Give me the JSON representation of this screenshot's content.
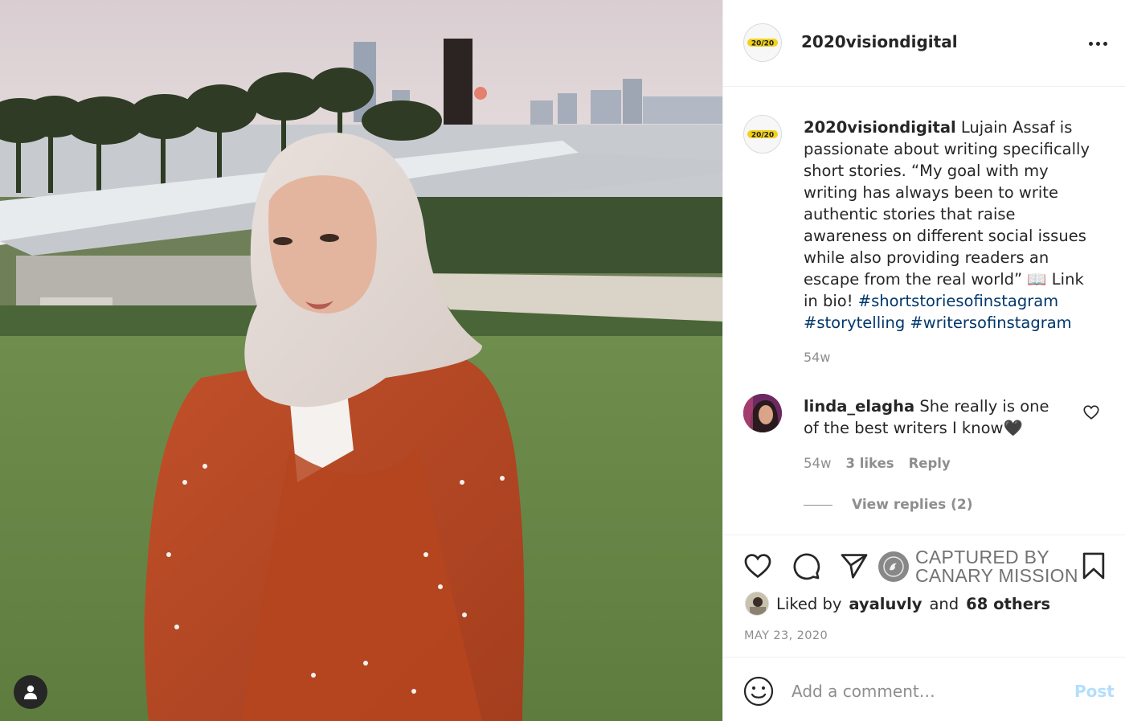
{
  "post": {
    "username": "2020visiondigital",
    "logo_text": "20/20",
    "caption": {
      "username": "2020visiondigital",
      "text": "Lujain Assaf is passionate about writing specifically short stories. “My goal with my writing has always been to write authentic stories that raise awareness on different social issues while also providing readers an escape from the real world” 📖 Link in bio!",
      "hashtags": [
        "#shortstoriesofinstagram",
        "#storytelling",
        "#writersofinstagram"
      ],
      "time": "54w"
    },
    "comments": [
      {
        "username": "linda_elagha",
        "text": "She really is one of the best writers I know🖤",
        "time": "54w",
        "likes": "3 likes",
        "reply_label": "Reply",
        "view_replies": "View replies (2)"
      }
    ],
    "watermark": {
      "line1": "CAPTURED BY",
      "line2": "CANARY MISSION"
    },
    "liked_by": {
      "prefix": "Liked by",
      "user": "ayaluvly",
      "middle": "and",
      "others": "68 others"
    },
    "date": "MAY 23, 2020",
    "composer": {
      "placeholder": "Add a comment…",
      "post_label": "Post"
    }
  },
  "icons": {
    "more": "more-options-icon",
    "heart": "heart-icon",
    "comment": "comment-icon",
    "share": "share-icon",
    "bookmark": "bookmark-icon",
    "emoji": "emoji-icon",
    "user_tag": "user-tag-icon"
  },
  "colors": {
    "text": "#262626",
    "muted": "#8e8e8e",
    "hashtag": "#00376b",
    "post_button": "#b2dffc",
    "divider": "#efefef"
  }
}
